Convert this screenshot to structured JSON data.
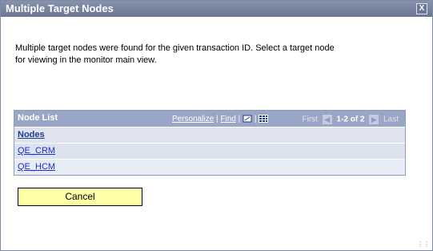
{
  "dialog": {
    "title": "Multiple Target Nodes",
    "close_label": "X",
    "message": "Multiple target nodes were found for the given transaction ID.  Select a target node for viewing in the monitor main view."
  },
  "grid": {
    "title": "Node List",
    "personalize": "Personalize",
    "separator": "|",
    "find": "Find",
    "first": "First",
    "range": "1-2 of 2",
    "last": "Last",
    "column": "Nodes",
    "rows": [
      "QE_CRM",
      "QE_HCM"
    ]
  },
  "buttons": {
    "cancel": "Cancel"
  }
}
